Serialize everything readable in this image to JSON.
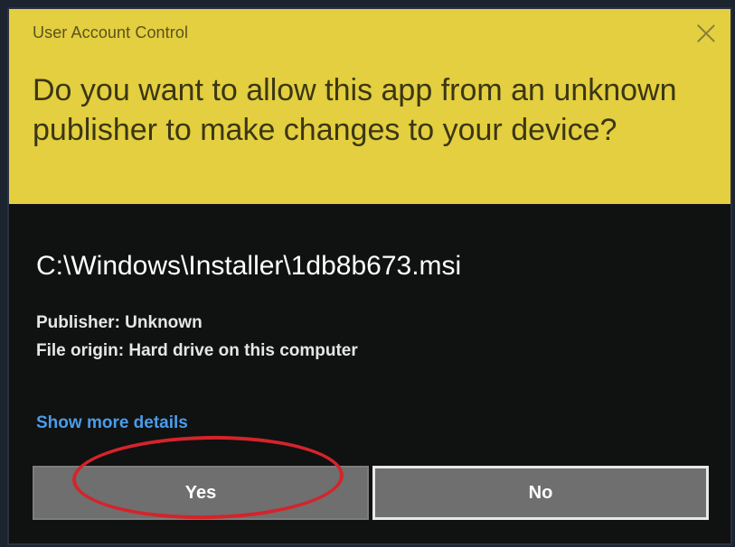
{
  "dialog": {
    "title": "User Account Control",
    "question": "Do you want to allow this app from an unknown publisher to make changes to your device?",
    "file_path": "C:\\Windows\\Installer\\1db8b673.msi",
    "publisher": "Publisher: Unknown",
    "file_origin": "File origin: Hard drive on this computer",
    "details_link": "Show more details",
    "buttons": {
      "yes_label": "Yes",
      "no_label": "No"
    }
  },
  "colors": {
    "header_background": "#e3cf3f",
    "body_background": "#101111",
    "link": "#4a9de9",
    "button_background": "#6f6f6f",
    "highlight_ring": "#d4242a"
  },
  "icons": {
    "close": "close-icon"
  }
}
